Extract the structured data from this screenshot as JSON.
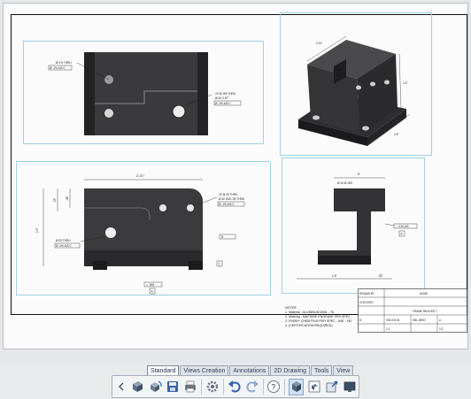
{
  "drawing": {
    "top_left_view": {
      "callout_1": "Ø.1% THRU",
      "callout_1_frame": "Ø .1% A B C",
      "callout_2": "2X Ø.169 THRU",
      "callout_2b": "Ø.40 X 87°",
      "callout_2_frame": "Ø .1% A B C"
    },
    "front_view": {
      "width_dim": "2.21\"",
      "callout_hole": "2X Ø.25 THRU",
      "callout_hole_b": "Ø.32 UNC 2B THRU",
      "callout_hole_frame": "Ø .1% A B C",
      "left_hole": "Ø.29 THRU",
      "left_hole_frame": "Ø .1% A B C",
      "datum_a": "A",
      "datum_b": "B",
      "datum_c": "C",
      "bottom_frame": "□ .005",
      "left_dim_1": ".93\"",
      "left_dim_2": ".48\"",
      "left_dim_3": "1.5\""
    },
    "side_view": {
      "top_dim": ".5\"",
      "top_dim_2": "Ø.10 Ø.155",
      "frame": "⊥ .010 A B",
      "bottom_dim_1": "1.5\"",
      "bottom_dim_2": ".25\"",
      "datum": "A"
    },
    "iso_view": {
      "dim_1": "2.21\"",
      "dim_2": "1.5\"",
      "dim_3": "2.5\""
    },
    "notes": {
      "heading": "NOTES:",
      "lines": [
        "1. Material : ALUMINUM 6061 - T6",
        "2. Marking : MACHINE ENGRAVE PER SPEC",
        "3. FINISH: CHEM FILM PER SPEC - NAT - HD",
        "4. (CERTIFICATION REQUIRED)"
      ]
    },
    "title_block": {
      "title": "FRAME BRACKET",
      "number": "SBL-BRKT",
      "scale": "1:1",
      "sheet": "1/1",
      "rev": "A",
      "drawn": "DRAWN BY",
      "checked": "CHECKED",
      "company": "ACME",
      "size": "B",
      "part_no": "000-00100"
    }
  },
  "tabs": [
    "Standard",
    "Views Creation",
    "Annotations",
    "2D Drawing",
    "Tools",
    "View"
  ],
  "active_tab": "Standard",
  "toolbar": [
    {
      "name": "collapse-arrow-icon"
    },
    {
      "name": "import-part-icon"
    },
    {
      "name": "rotate-part-icon"
    },
    {
      "name": "save-icon"
    },
    {
      "name": "print-icon"
    },
    {
      "name": "settings-gear-icon"
    },
    {
      "name": "undo-icon"
    },
    {
      "name": "redo-icon"
    },
    {
      "name": "help-icon"
    },
    {
      "name": "3d-view-icon"
    },
    {
      "name": "drawing-icon"
    },
    {
      "name": "export-icon"
    },
    {
      "name": "screen-icon"
    }
  ],
  "colors": {
    "view_frame": "#9fd0e6",
    "part_fill": "#3a3a3c",
    "part_dark": "#1f1f21",
    "accent": "#2a3f5c"
  }
}
